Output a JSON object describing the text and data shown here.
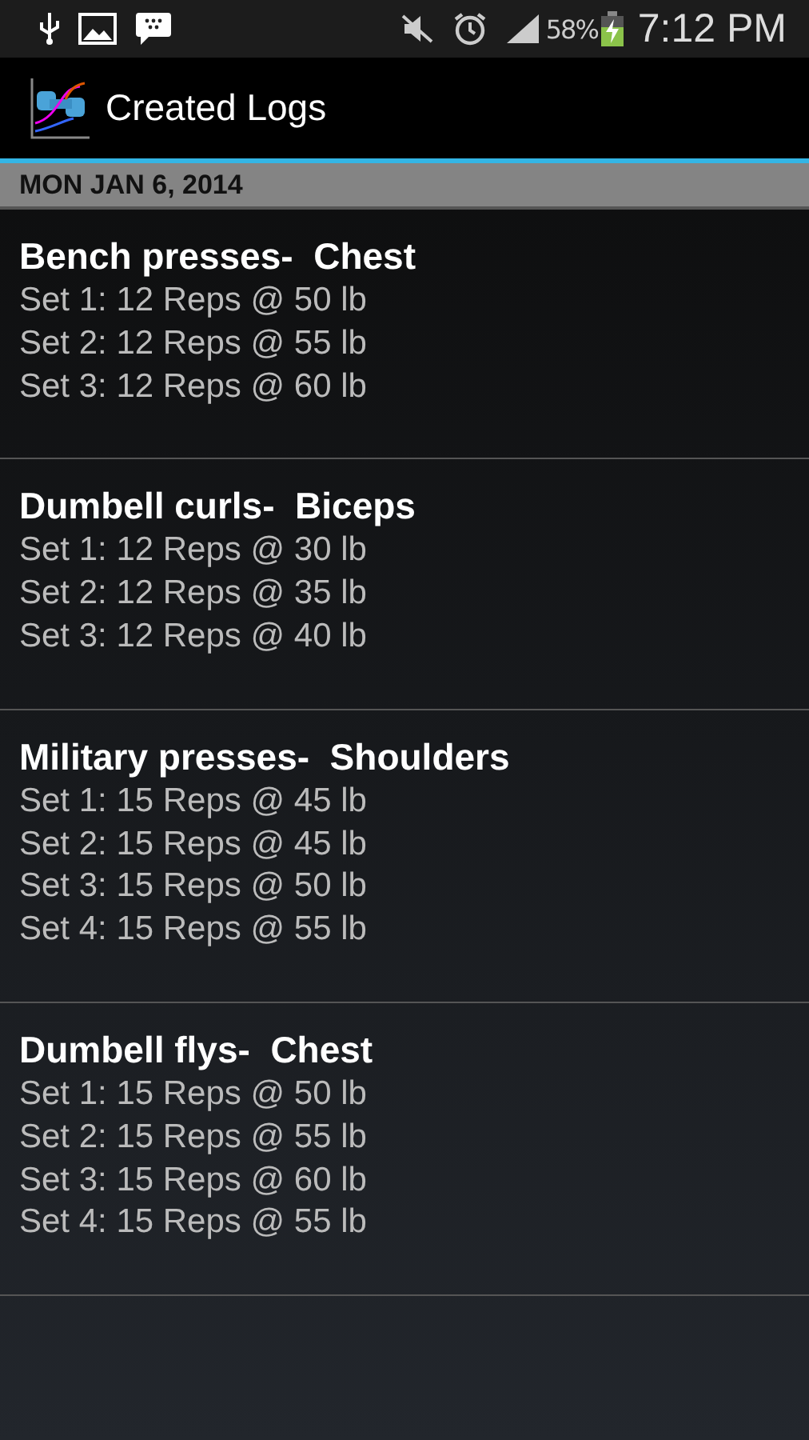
{
  "status_bar": {
    "battery_text": "58%",
    "time": "7:12 PM"
  },
  "action_bar": {
    "title": "Created Logs"
  },
  "section": {
    "header": "MON JAN 6, 2014"
  },
  "logs": [
    {
      "exercise": "Bench presses-  Chest",
      "sets": [
        "Set 1: 12 Reps @ 50 lb",
        "Set 2: 12 Reps @ 55 lb",
        "Set 3: 12 Reps @ 60 lb"
      ]
    },
    {
      "exercise": "Dumbell curls-  Biceps",
      "sets": [
        "Set 1: 12 Reps @ 30 lb",
        "Set 2: 12 Reps @ 35 lb",
        "Set 3: 12 Reps @ 40 lb"
      ]
    },
    {
      "exercise": "Military presses-  Shoulders",
      "sets": [
        "Set 1: 15 Reps @ 45 lb",
        "Set 2: 15 Reps @ 45 lb",
        "Set 3: 15 Reps @ 50 lb",
        "Set 4: 15 Reps @ 55 lb"
      ]
    },
    {
      "exercise": "Dumbell flys-  Chest",
      "sets": [
        "Set 1: 15 Reps @ 50 lb",
        "Set 2: 15 Reps @ 55 lb",
        "Set 3: 15 Reps @ 60 lb",
        "Set 4: 15 Reps @ 55 lb"
      ]
    }
  ]
}
